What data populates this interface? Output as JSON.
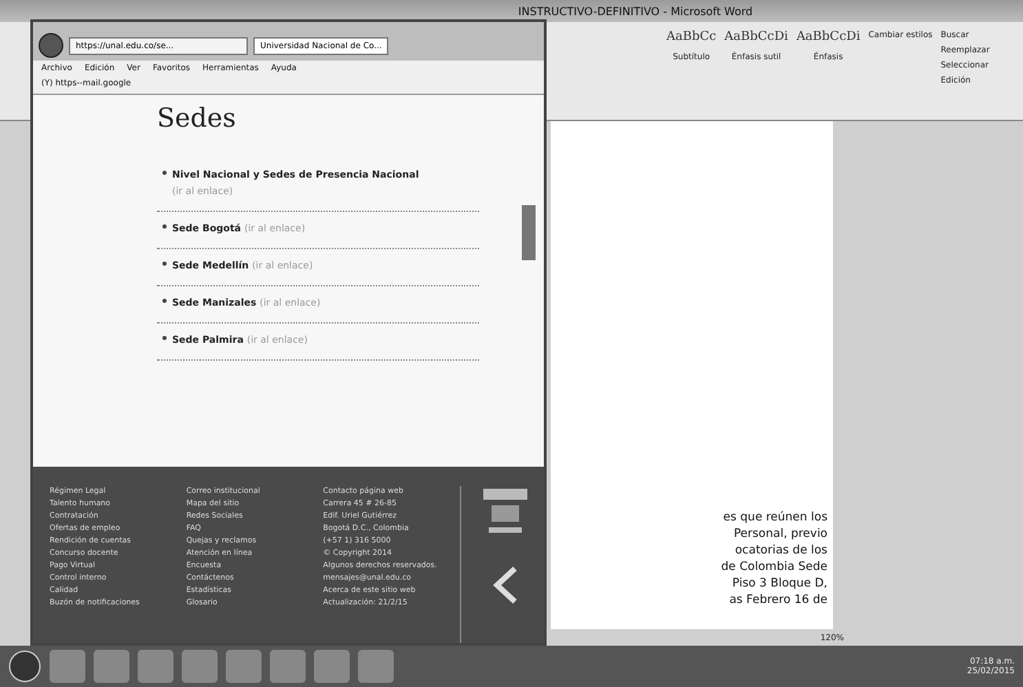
{
  "word": {
    "title": "INSTRUCTIVO-DEFINITIVO - Microsoft Word",
    "styles": [
      {
        "sample": "AaBbCc",
        "label": "Subtítulo"
      },
      {
        "sample": "AaBbCcDi",
        "label": "Énfasis sutil"
      },
      {
        "sample": "AaBbCcDi",
        "label": "Énfasis"
      }
    ],
    "change_styles": "Cambiar estilos",
    "editing": [
      "Buscar",
      "Reemplazar",
      "Seleccionar"
    ],
    "editing_group": "Edición",
    "document_lines": [
      "es que reúnen los",
      "Personal, previo",
      "ocatorias de los",
      "de Colombia Sede",
      "Piso 3 Bloque D,",
      "as Febrero 16 de"
    ],
    "zoom": "120%"
  },
  "browser": {
    "address": "https://unal.edu.co/se...",
    "tab": "Universidad Nacional de Co...",
    "menu": [
      "Archivo",
      "Edición",
      "Ver",
      "Favoritos",
      "Herramientas",
      "Ayuda"
    ],
    "favorite": "(Y) https--mail.google",
    "heading": "Sedes",
    "sedes": [
      {
        "name": "Nivel Nacional y Sedes de Presencia Nacional",
        "link": "(ir al enlace)"
      },
      {
        "name": "Sede Bogotá",
        "link": "(ir al enlace)"
      },
      {
        "name": "Sede Medellín",
        "link": "(ir al enlace)"
      },
      {
        "name": "Sede Manizales",
        "link": "(ir al enlace)"
      },
      {
        "name": "Sede Palmira",
        "link": "(ir al enlace)"
      }
    ],
    "footer_columns": [
      [
        "Régimen Legal",
        "Talento humano",
        "Contratación",
        "Ofertas de empleo",
        "Rendición de cuentas",
        "Concurso docente",
        "Pago Virtual",
        "Control interno",
        "Calidad",
        "Buzón de notificaciones"
      ],
      [
        "Correo institucional",
        "Mapa del sitio",
        "Redes Sociales",
        "FAQ",
        "Quejas y reclamos",
        "Atención en línea",
        "Encuesta",
        "Contáctenos",
        "Estadísticas",
        "Glosario"
      ],
      [
        "Contacto página web",
        "Carrera 45 # 26-85",
        "Edif. Uriel Gutiérrez",
        "Bogotá D.C., Colombia",
        "(+57 1) 316 5000",
        "© Copyright 2014",
        "Algunos derechos reservados.",
        "mensajes@unal.edu.co",
        "Acerca de este sitio web",
        "Actualización: 21/2/15"
      ]
    ]
  },
  "taskbar": {
    "time": "07:18 a.m.",
    "date": "25/02/2015"
  }
}
